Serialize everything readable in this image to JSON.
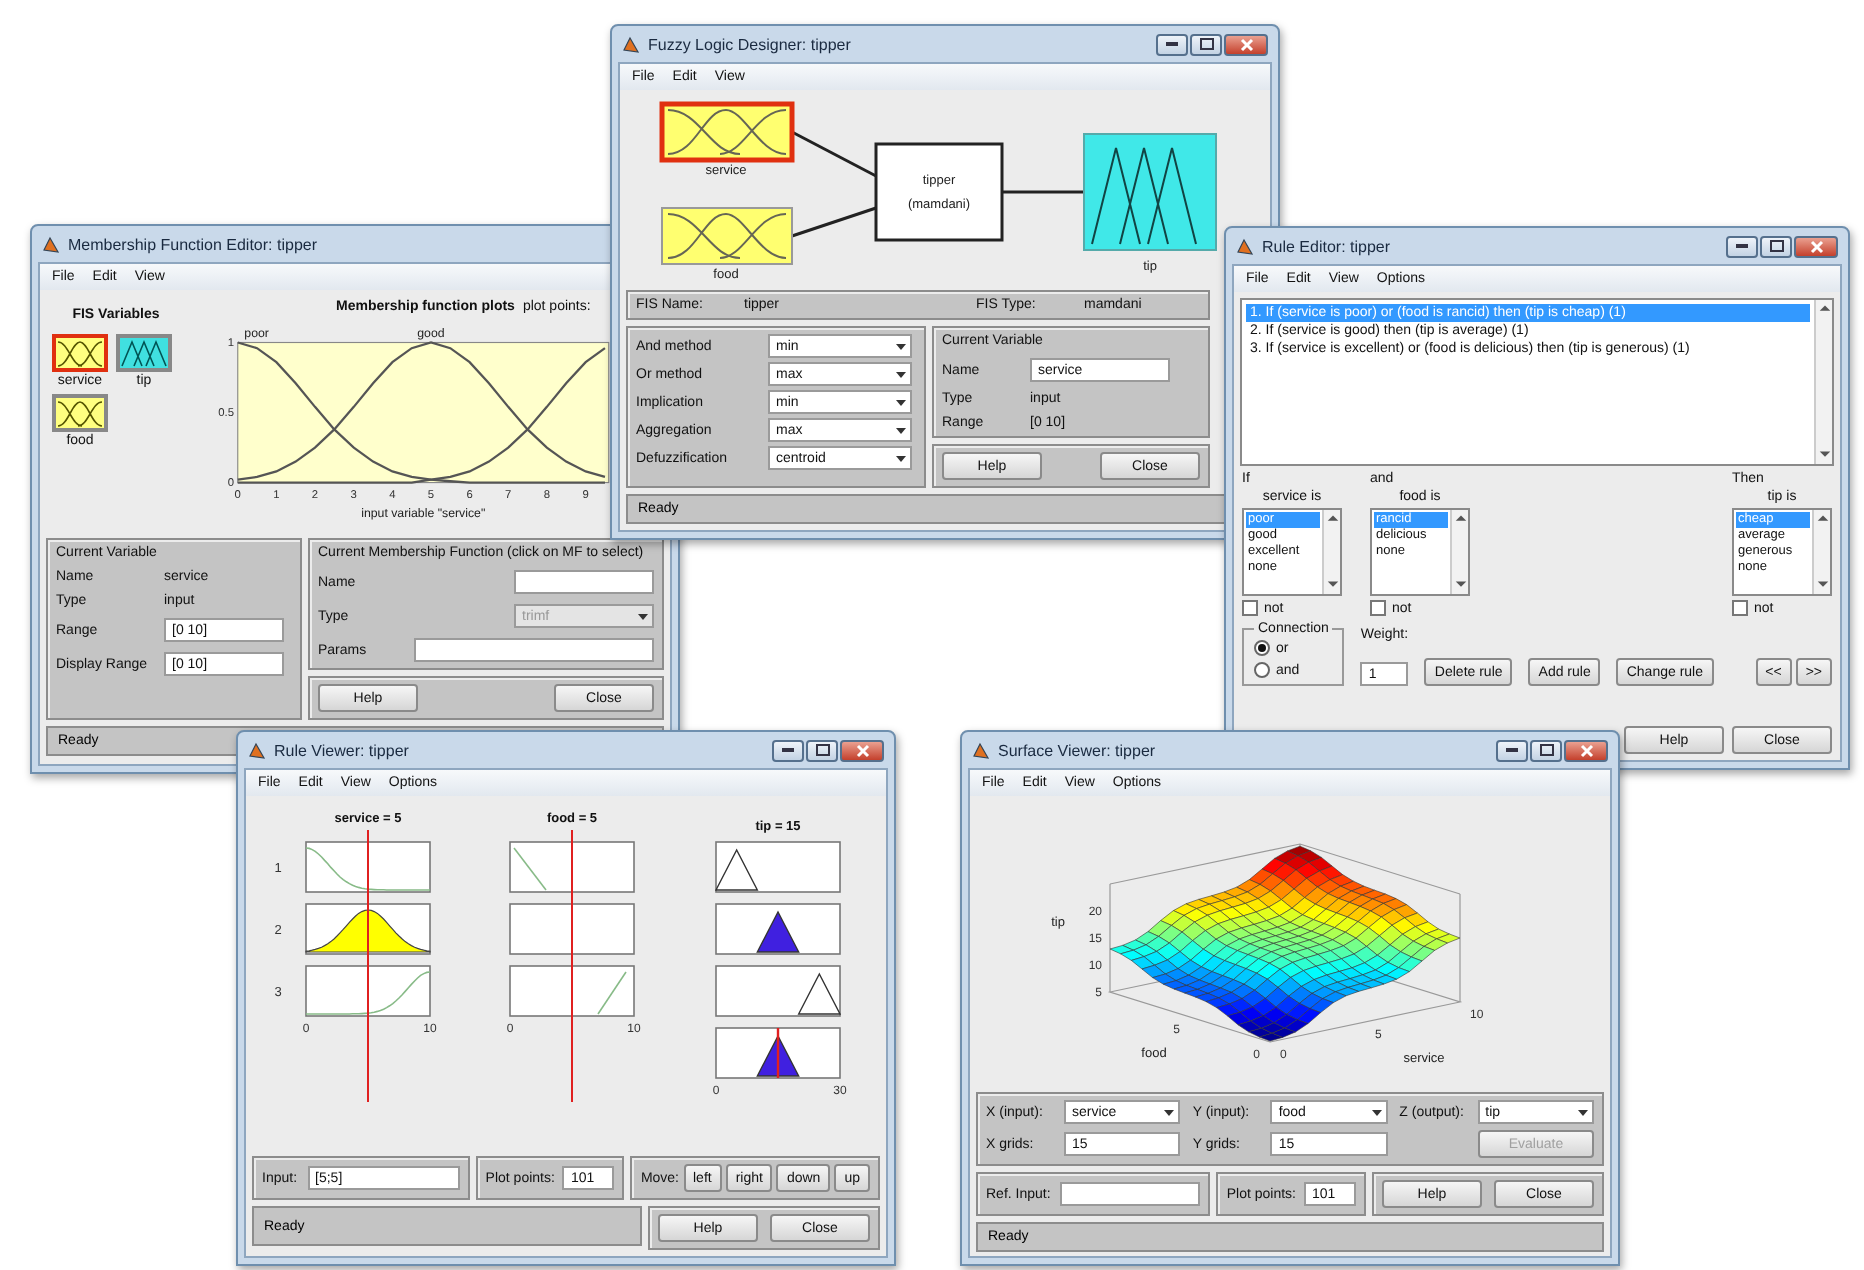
{
  "mf_editor": {
    "title": "Membership Function Editor: tipper",
    "menu": [
      "File",
      "Edit",
      "View"
    ],
    "fis_variables_label": "FIS Variables",
    "variables": [
      {
        "name": "service",
        "kind": "input",
        "selected": true
      },
      {
        "name": "tip",
        "kind": "output",
        "selected": false
      },
      {
        "name": "food",
        "kind": "input",
        "selected": false
      }
    ],
    "plot_points_label": "plot points:",
    "chart_data": {
      "type": "line",
      "title": "Membership function plots",
      "xlabel": "input variable \"service\"",
      "x": [
        0,
        0.5,
        1,
        1.5,
        2,
        2.5,
        3,
        3.5,
        4,
        4.5,
        5,
        5.5,
        6,
        6.5,
        7,
        7.5,
        8,
        8.5,
        9,
        9.5
      ],
      "series": [
        {
          "name": "poor",
          "values": [
            1,
            0.96,
            0.86,
            0.71,
            0.54,
            0.38,
            0.25,
            0.15,
            0.08,
            0.04,
            0.02,
            0.01,
            0,
            0,
            0,
            0,
            0,
            0,
            0,
            0
          ]
        },
        {
          "name": "good",
          "values": [
            0.02,
            0.04,
            0.08,
            0.15,
            0.25,
            0.38,
            0.54,
            0.71,
            0.86,
            0.96,
            1,
            0.96,
            0.86,
            0.71,
            0.54,
            0.38,
            0.25,
            0.15,
            0.08,
            0.04
          ]
        },
        {
          "values": [
            0,
            0,
            0,
            0,
            0,
            0,
            0,
            0,
            0,
            0,
            0.02,
            0.04,
            0.08,
            0.15,
            0.25,
            0.38,
            0.54,
            0.71,
            0.86,
            0.96
          ]
        }
      ],
      "xlim": [
        0,
        9.6
      ],
      "ylim": [
        0,
        1
      ],
      "xticks": [
        {
          "value": 0,
          "label": "0"
        },
        1,
        2,
        3,
        4,
        5,
        6,
        7,
        8,
        9
      ],
      "yticks": [
        {
          "value": 0,
          "label": "0"
        },
        0.5,
        1
      ]
    },
    "current_variable": {
      "heading": "Current Variable",
      "fields": [
        {
          "label": "Name",
          "kind": "text",
          "value": "service"
        },
        {
          "label": "Type",
          "kind": "text",
          "value": "input"
        },
        {
          "label": "Range",
          "kind": "input",
          "value": "[0 10]"
        },
        {
          "label": "Display Range",
          "kind": "input",
          "value": "[0 10]"
        }
      ]
    },
    "current_mf": {
      "heading": "Current Membership Function (click on MF to select)",
      "fields": [
        {
          "label": "Name",
          "kind": "input"
        },
        {
          "label": "Type",
          "kind": "select",
          "value": "trimf"
        },
        {
          "label": "Params",
          "kind": "input"
        }
      ]
    },
    "buttons": [
      "Help",
      "Close"
    ],
    "status": "Ready"
  },
  "designer": {
    "title": "Fuzzy Logic Designer: tipper",
    "menu": [
      "File",
      "Edit",
      "View"
    ],
    "inputs": [
      {
        "name": "service",
        "selected": true
      },
      {
        "name": "food",
        "selected": false
      }
    ],
    "system": {
      "name": "tipper",
      "type": "(mamdani)"
    },
    "output": {
      "name": "tip",
      "selected": false
    },
    "fis_name_label": "FIS Name:",
    "fis_name": "tipper",
    "fis_type_label": "FIS Type:",
    "fis_type": "mamdani",
    "methods": [
      {
        "label": "And method",
        "value": "min"
      },
      {
        "label": "Or method",
        "value": "max"
      },
      {
        "label": "Implication",
        "value": "min"
      },
      {
        "label": "Aggregation",
        "value": "max"
      },
      {
        "label": "Defuzzification",
        "value": "centroid"
      }
    ],
    "current_variable": {
      "heading": "Current Variable",
      "fields": [
        {
          "label": "Name",
          "kind": "input",
          "value": "service"
        },
        {
          "label": "Type",
          "kind": "text",
          "value": "input"
        },
        {
          "label": "Range",
          "kind": "text",
          "value": "[0 10]"
        }
      ]
    },
    "buttons": [
      "Help",
      "Close"
    ],
    "status": "Ready"
  },
  "rule_editor": {
    "title": "Rule Editor: tipper",
    "menu": [
      "File",
      "Edit",
      "View",
      "Options"
    ],
    "rules": [
      {
        "text": "1. If (service is poor) or (food is rancid) then (tip is cheap) (1)",
        "selected": true
      },
      {
        "text": "2. If (service is good) then (tip is average) (1)",
        "selected": false
      },
      {
        "text": "3. If (service is excellent) or (food is delicious) then (tip is generous) (1)",
        "selected": false
      }
    ],
    "selectors": [
      {
        "connector": "If",
        "label": "service is",
        "options": [
          {
            "label": "poor",
            "selected": true
          },
          {
            "label": "good",
            "selected": false
          },
          {
            "label": "excellent",
            "selected": false
          },
          {
            "label": "none",
            "selected": false
          }
        ],
        "not_label": "not",
        "not": false
      },
      {
        "connector": "and",
        "label": "food is",
        "options": [
          {
            "label": "rancid",
            "selected": true
          },
          {
            "label": "delicious",
            "selected": false
          },
          {
            "label": "none",
            "selected": false
          }
        ],
        "not_label": "not",
        "not": false
      },
      {
        "connector": "Then",
        "label": "tip is",
        "options": [
          {
            "label": "cheap",
            "selected": true
          },
          {
            "label": "average",
            "selected": false
          },
          {
            "label": "generous",
            "selected": false
          },
          {
            "label": "none",
            "selected": false
          }
        ],
        "not_label": "not",
        "not": false
      }
    ],
    "connection": {
      "heading": "Connection",
      "options": [
        {
          "label": "or",
          "selected": true
        },
        {
          "label": "and",
          "selected": false
        }
      ]
    },
    "weight_label": "Weight:",
    "weight": "1",
    "actions": [
      "Delete rule",
      "Add rule",
      "Change rule"
    ],
    "nav": [
      "<<",
      ">>"
    ],
    "buttons": [
      "Help",
      "Close"
    ]
  },
  "rule_viewer": {
    "title": "Rule Viewer: tipper",
    "menu": [
      "File",
      "Edit",
      "View",
      "Options"
    ],
    "columns": [
      {
        "label": "service = 5",
        "kind": "input",
        "axis": [
          "0",
          "10"
        ]
      },
      {
        "label": "food = 5",
        "kind": "input",
        "axis": [
          "0",
          "10"
        ]
      },
      {
        "label": "tip = 15",
        "kind": "output",
        "axis": [
          "0",
          "30"
        ]
      }
    ],
    "rule_numbers": [
      "1",
      "2",
      "3"
    ],
    "input_label": "Input:",
    "input": "[5;5]",
    "plot_points_label": "Plot points:",
    "plot_points": "101",
    "move_label": "Move:",
    "move_buttons": [
      "left",
      "right",
      "down",
      "up"
    ],
    "status": "Ready",
    "buttons": [
      "Help",
      "Close"
    ]
  },
  "surface_viewer": {
    "title": "Surface Viewer: tipper",
    "menu": [
      "File",
      "Edit",
      "View",
      "Options"
    ],
    "zlabel": "tip",
    "zticks": [
      "20",
      "15",
      "10",
      "5"
    ],
    "xlabel": "service",
    "xticks": [
      "0",
      "5",
      "10"
    ],
    "ylabel": "food",
    "yticks": [
      "0",
      "5"
    ],
    "axes": [
      {
        "label": "X (input):",
        "value": "service"
      },
      {
        "label": "Y (input):",
        "value": "food"
      },
      {
        "label": "Z (output):",
        "value": "tip"
      }
    ],
    "grids": [
      {
        "label": "X grids:",
        "value": "15"
      },
      {
        "label": "Y grids:",
        "value": "15"
      }
    ],
    "evaluate": {
      "label": "Evaluate",
      "disabled": true
    },
    "ref_input_label": "Ref. Input:",
    "plot_points_label": "Plot points:",
    "plot_points": "101",
    "buttons": [
      "Help",
      "Close"
    ],
    "status": "Ready"
  }
}
